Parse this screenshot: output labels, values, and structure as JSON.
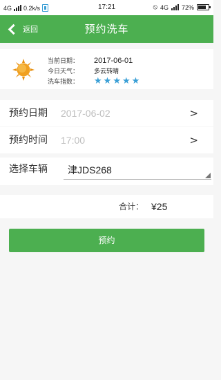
{
  "status_bar": {
    "network": "4G",
    "speed": "0.2k/s",
    "time": "17:21",
    "network_right": "4G",
    "battery": "72%"
  },
  "header": {
    "back_label": "返回",
    "title": "预约洗车"
  },
  "weather": {
    "date_label": "当前日期：",
    "date_value": "2017-06-01",
    "weather_label": "今日天气：",
    "weather_value": "多云转晴",
    "index_label": "洗车指数：",
    "index_rating": 5,
    "icon": "sun-icon"
  },
  "booking": {
    "date_label": "预约日期",
    "date_value": "2017-06-02",
    "time_label": "预约时间",
    "time_value": "17:00",
    "arrow": ">",
    "vehicle_label": "选择车辆",
    "vehicle_value": "津JDS268"
  },
  "total": {
    "label": "合计：",
    "value": "¥25"
  },
  "actions": {
    "submit_label": "预约"
  },
  "colors": {
    "accent": "#4caf50",
    "star": "#3a9fd6"
  }
}
